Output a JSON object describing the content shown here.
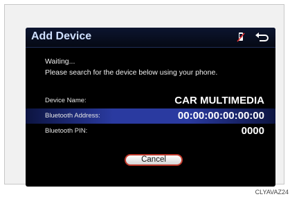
{
  "header": {
    "title": "Add Device",
    "icons": [
      "phone-icon",
      "back-icon"
    ]
  },
  "status": {
    "line1": "Waiting...",
    "line2": "Please search for the device below using your phone."
  },
  "device_info": [
    {
      "label": "Device Name:",
      "value": "CAR MULTIMEDIA"
    },
    {
      "label": "Bluetooth Address:",
      "value": "00:00:00:00:00:00"
    },
    {
      "label": "Bluetooth PIN:",
      "value": "0000"
    }
  ],
  "buttons": {
    "cancel": "Cancel"
  },
  "figure_code": "CLYAVAZ24",
  "colors": {
    "title": "#cfe0ff",
    "highlight_row": "#2a3aa0",
    "cancel_border": "#c0392b"
  }
}
